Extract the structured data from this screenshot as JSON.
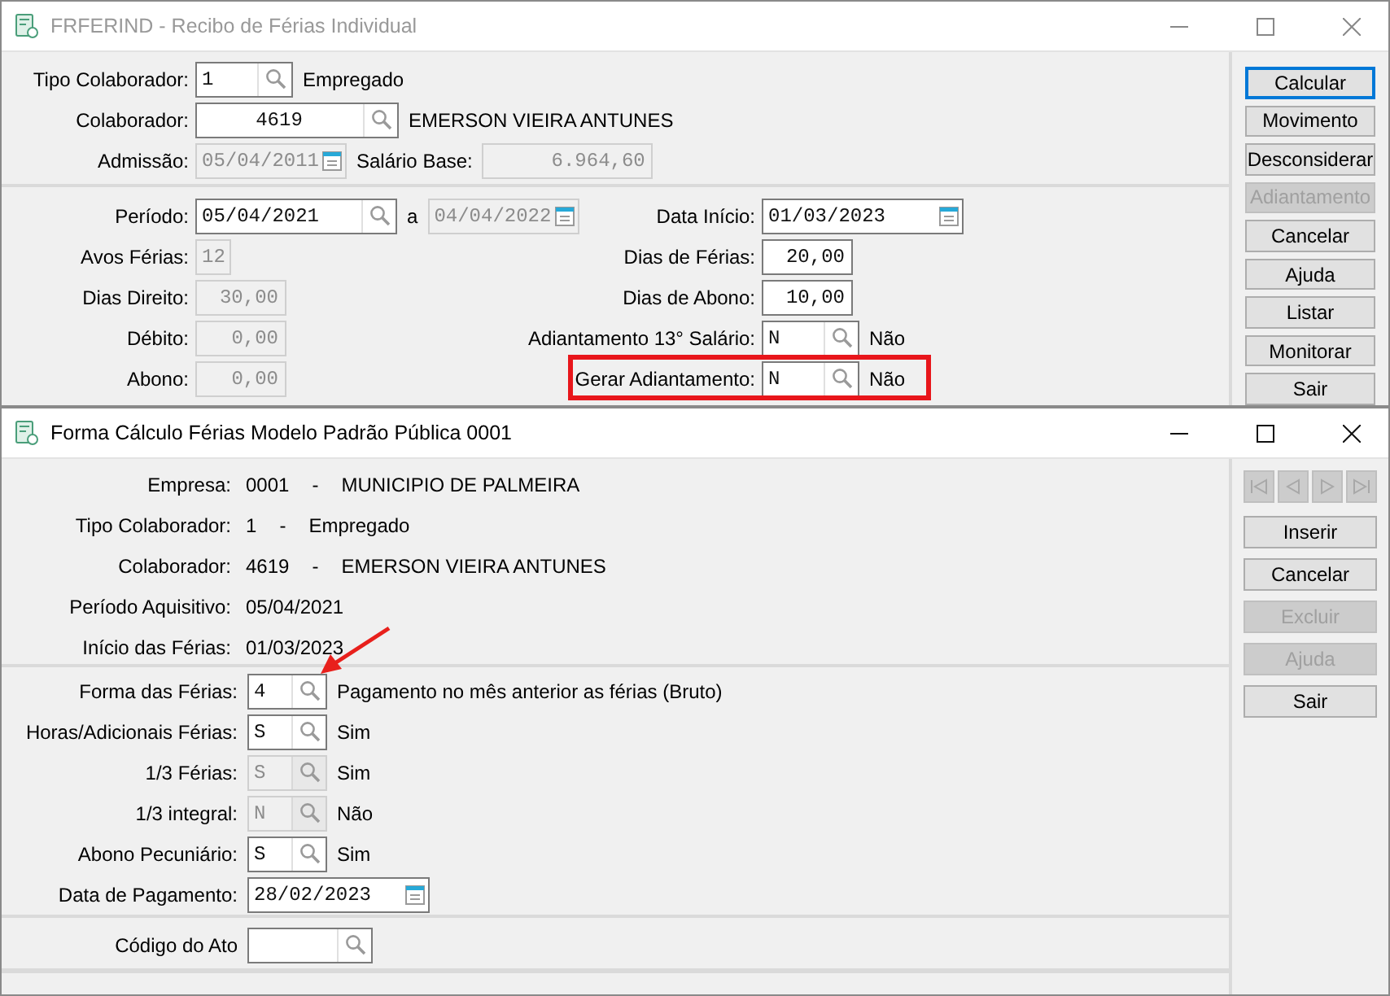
{
  "back_window": {
    "title": "FRFERIND - Recibo de Férias Individual",
    "active": false,
    "header_rows": [
      {
        "label": "Tipo Colaborador:",
        "parts": [
          {
            "kind": "code",
            "value": "1",
            "disabled": false
          },
          {
            "kind": "text",
            "text": "Empregado"
          }
        ]
      },
      {
        "label": "Colaborador:",
        "parts": [
          {
            "kind": "id",
            "value": "4619",
            "disabled": false
          },
          {
            "kind": "text",
            "text": "EMERSON VIEIRA ANTUNES"
          }
        ]
      },
      {
        "label": "Admissão:",
        "parts": [
          {
            "kind": "date",
            "value": "05/04/2011",
            "disabled": true
          },
          {
            "kind": "text",
            "text": "Salário Base:"
          },
          {
            "kind": "money",
            "value": "6.964,60",
            "disabled": true
          }
        ]
      }
    ],
    "detail_rows": [
      {
        "left": {
          "label": "Período:",
          "parts": [
            {
              "kind": "datelookup",
              "value": "05/04/2021",
              "disabled": false
            },
            {
              "kind": "text",
              "text": "a"
            },
            {
              "kind": "date",
              "value": "04/04/2022",
              "disabled": true
            }
          ]
        },
        "right": {
          "label": "Data Início:",
          "highlighted": false,
          "parts": [
            {
              "kind": "datewide",
              "value": "01/03/2023",
              "disabled": false
            }
          ]
        }
      },
      {
        "left": {
          "label": "Avos Férias:",
          "parts": [
            {
              "kind": "short",
              "value": "12",
              "disabled": true
            }
          ]
        },
        "right": {
          "label": "Dias de Férias:",
          "highlighted": false,
          "parts": [
            {
              "kind": "number",
              "value": "20,00",
              "disabled": false
            }
          ]
        }
      },
      {
        "left": {
          "label": "Dias Direito:",
          "parts": [
            {
              "kind": "number",
              "value": "30,00",
              "disabled": true
            }
          ]
        },
        "right": {
          "label": "Dias de Abono:",
          "highlighted": false,
          "parts": [
            {
              "kind": "number",
              "value": "10,00",
              "disabled": false
            }
          ]
        }
      },
      {
        "left": {
          "label": "Débito:",
          "parts": [
            {
              "kind": "number",
              "value": "0,00",
              "disabled": true
            }
          ]
        },
        "right": {
          "label": "Adiantamento 13° Salário:",
          "highlighted": false,
          "parts": [
            {
              "kind": "code",
              "value": "N",
              "disabled": false
            },
            {
              "kind": "text",
              "text": "Não"
            }
          ]
        }
      },
      {
        "left": {
          "label": "Abono:",
          "parts": [
            {
              "kind": "number",
              "value": "0,00",
              "disabled": true
            }
          ]
        },
        "right": {
          "label": "Gerar Adiantamento:",
          "highlighted": true,
          "parts": [
            {
              "kind": "code",
              "value": "N",
              "disabled": false
            },
            {
              "kind": "text",
              "text": "Não"
            }
          ]
        }
      }
    ],
    "buttons": [
      {
        "label": "Calcular",
        "disabled": false,
        "focused": true
      },
      {
        "label": "Movimento",
        "disabled": false,
        "focused": false
      },
      {
        "label": "Desconsiderar",
        "disabled": false,
        "focused": false
      },
      {
        "label": "Adiantamento",
        "disabled": true,
        "focused": false
      },
      {
        "label": "Cancelar",
        "disabled": false,
        "focused": false
      },
      {
        "label": "Ajuda",
        "disabled": false,
        "focused": false
      },
      {
        "label": "Listar",
        "disabled": false,
        "focused": false
      },
      {
        "label": "Monitorar",
        "disabled": false,
        "focused": false
      },
      {
        "label": "Sair",
        "disabled": false,
        "focused": false
      }
    ]
  },
  "front_window": {
    "title": "Forma Cálculo Férias Modelo Padrão Pública 0001",
    "active": true,
    "info_rows": [
      {
        "label": "Empresa:",
        "values": [
          "0001",
          "-",
          "MUNICIPIO DE PALMEIRA"
        ]
      },
      {
        "label": "Tipo Colaborador:",
        "values": [
          "1",
          "-",
          "Empregado"
        ]
      },
      {
        "label": "Colaborador:",
        "values": [
          "4619",
          "-",
          "EMERSON VIEIRA ANTUNES"
        ]
      },
      {
        "label": "Período Aquisitivo:",
        "values": [
          "05/04/2021"
        ]
      },
      {
        "label": "Início das Férias:",
        "values": [
          "01/03/2023"
        ]
      }
    ],
    "form_rows": [
      {
        "label": "Forma das Férias:",
        "pointed": true,
        "parts": [
          {
            "kind": "flag",
            "value": "4",
            "disabled": false
          },
          {
            "kind": "text",
            "text": "Pagamento no mês anterior as férias (Bruto)"
          }
        ]
      },
      {
        "label": "Horas/Adicionais Férias:",
        "pointed": false,
        "parts": [
          {
            "kind": "flag",
            "value": "S",
            "disabled": false
          },
          {
            "kind": "text",
            "text": "Sim"
          }
        ]
      },
      {
        "label": "1/3 Férias:",
        "pointed": false,
        "parts": [
          {
            "kind": "flag",
            "value": "S",
            "disabled": true
          },
          {
            "kind": "text",
            "text": "Sim"
          }
        ]
      },
      {
        "label": "1/3 integral:",
        "pointed": false,
        "parts": [
          {
            "kind": "flag",
            "value": "N",
            "disabled": true
          },
          {
            "kind": "text",
            "text": "Não"
          }
        ]
      },
      {
        "label": "Abono Pecuniário:",
        "pointed": false,
        "parts": [
          {
            "kind": "flag",
            "value": "S",
            "disabled": false
          },
          {
            "kind": "text",
            "text": "Sim"
          }
        ]
      },
      {
        "label": "Data de Pagamento:",
        "pointed": false,
        "parts": [
          {
            "kind": "datepay",
            "value": "28/02/2023",
            "disabled": false
          }
        ]
      }
    ],
    "act_row": {
      "label": "Código do Ato",
      "parts": [
        {
          "kind": "act",
          "disabled": false
        }
      ]
    },
    "nav_buttons": [
      {
        "kind": "first",
        "disabled": true
      },
      {
        "kind": "prev",
        "disabled": true
      },
      {
        "kind": "next",
        "disabled": true
      },
      {
        "kind": "last",
        "disabled": true
      }
    ],
    "buttons": [
      {
        "label": "Inserir",
        "disabled": false,
        "focused": false
      },
      {
        "label": "Cancelar",
        "disabled": false,
        "focused": false
      },
      {
        "label": "Excluir",
        "disabled": true,
        "focused": false
      },
      {
        "label": "Ajuda",
        "disabled": true,
        "focused": false
      },
      {
        "label": "Sair",
        "disabled": false,
        "focused": false
      }
    ]
  }
}
